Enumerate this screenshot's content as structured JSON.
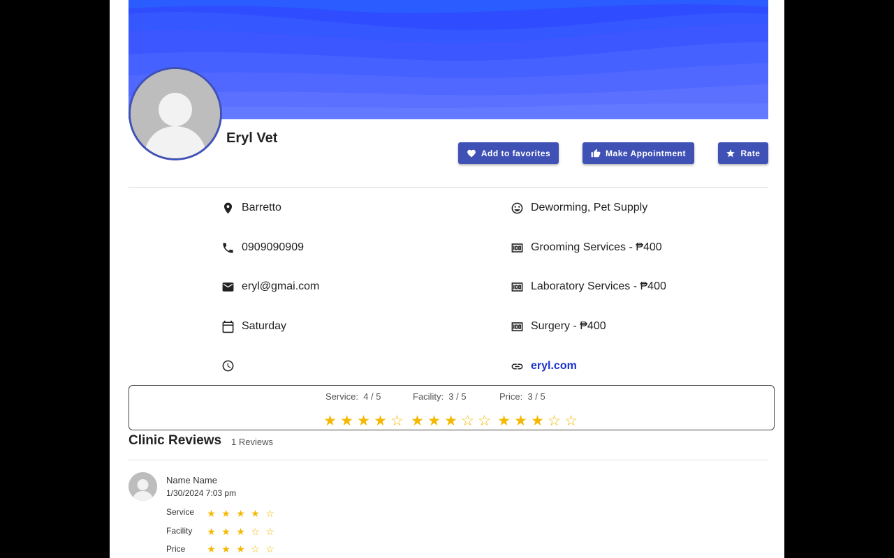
{
  "profile": {
    "name": "Eryl Vet"
  },
  "actions": {
    "favorites_label": "Add to favorites",
    "appointment_label": "Make Appointment",
    "rate_label": "Rate"
  },
  "info_left": [
    {
      "icon": "location-pin-icon",
      "text": "Barretto"
    },
    {
      "icon": "phone-icon",
      "text": "0909090909"
    },
    {
      "icon": "email-icon",
      "text": "eryl@gmai.com"
    },
    {
      "icon": "calendar-icon",
      "text": "Saturday"
    },
    {
      "icon": "clock-icon",
      "text": ""
    }
  ],
  "info_right": [
    {
      "icon": "smiley-icon",
      "text": "Deworming, Pet Supply"
    },
    {
      "icon": "money-icon",
      "text": "Grooming Services - ₱400"
    },
    {
      "icon": "money-icon",
      "text": "Laboratory Services - ₱400"
    },
    {
      "icon": "money-icon",
      "text": "Surgery - ₱400"
    },
    {
      "icon": "link-icon",
      "text": "eryl.com"
    }
  ],
  "summary": {
    "service": {
      "label": "Service:",
      "value": "4 / 5",
      "score": 4
    },
    "facility": {
      "label": "Facility:",
      "value": "3 / 5",
      "score": 3
    },
    "price": {
      "label": "Price:",
      "value": "3 / 5",
      "score": 3
    }
  },
  "reviews": {
    "title": "Clinic Reviews",
    "count": "1 Reviews",
    "items": [
      {
        "name": "Name Name",
        "date": "1/30/2024 7:03 pm",
        "ratings": [
          {
            "label": "Service",
            "score": 4
          },
          {
            "label": "Facility",
            "score": 3
          },
          {
            "label": "Price",
            "score": 3
          }
        ]
      }
    ]
  },
  "colors": {
    "primary": "#3f51b5",
    "star": "#f5b800",
    "link": "#1a33cc",
    "banner": "#3d5bff"
  }
}
